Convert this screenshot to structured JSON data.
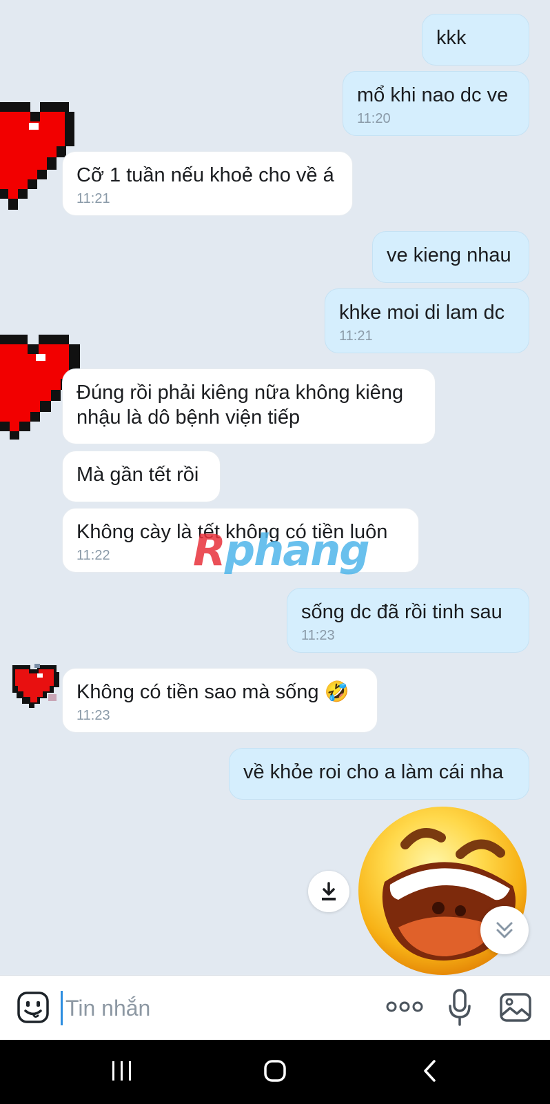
{
  "messages": [
    {
      "text": "kkk",
      "time": ""
    },
    {
      "text": "mổ khi nao dc ve",
      "time": "11:20"
    },
    {
      "text": "Cỡ 1 tuần nếu khoẻ cho về á",
      "time": "11:21"
    },
    {
      "text": "ve kieng nhau",
      "time": ""
    },
    {
      "text": "khke moi di lam dc",
      "time": "11:21"
    },
    {
      "text": "Đúng rồi phải kiêng nữa không kiêng nhậu là dô bệnh viện tiếp",
      "time": ""
    },
    {
      "text": "Mà gần tết rồi",
      "time": ""
    },
    {
      "text": "Không cày là tết không có tiền luôn",
      "time": "11:22"
    },
    {
      "text": "sống dc đã rồi tinh sau",
      "time": "11:23"
    },
    {
      "text": "Không có tiền sao mà sống 🤣",
      "time": "11:23"
    },
    {
      "text": "về khỏe roi cho a làm cái nha",
      "time": ""
    }
  ],
  "watermark": {
    "first": "R",
    "rest": "phang"
  },
  "composer": {
    "placeholder": "Tin nhắn"
  },
  "icons": {
    "avatar": "pixel-heart-icon",
    "sticker": "laughing-face-sticker",
    "download": "download-icon",
    "scroll_down": "double-chevron-down-icon",
    "emoji": "emoji-face-icon",
    "more": "more-dots-icon",
    "mic": "microphone-icon",
    "image": "image-icon",
    "recent_apps": "recent-apps-icon",
    "home": "home-icon",
    "back": "back-icon"
  },
  "colors": {
    "chat_background": "#e2e9f1",
    "outgoing_bubble": "#d5eefd",
    "incoming_bubble": "#ffffff",
    "heart_red": "#f20000",
    "cursor_blue": "#2c8de0"
  }
}
